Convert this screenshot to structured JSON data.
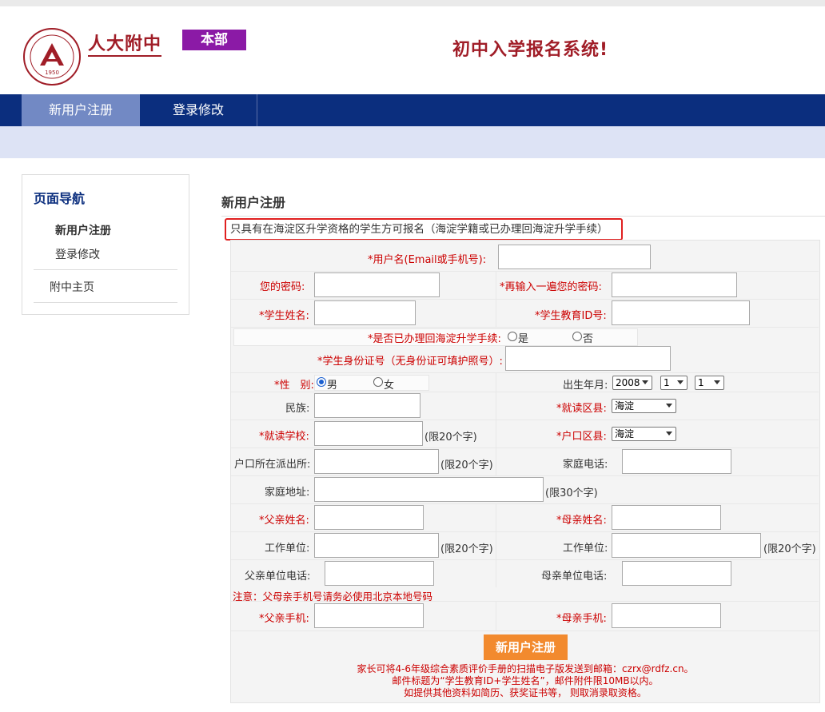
{
  "header": {
    "brand": "人大附中",
    "badge": "本部",
    "system_title": "初中入学报名系统!",
    "logo_year": "1950"
  },
  "nav": {
    "items": [
      {
        "label": "新用户注册",
        "active": true
      },
      {
        "label": "登录修改",
        "active": false
      }
    ]
  },
  "sidebar": {
    "title": "页面导航",
    "links": [
      "新用户注册",
      "登录修改",
      "附中主页"
    ]
  },
  "main": {
    "title": "新用户注册",
    "notice": "只具有在海淀区升学资格的学生方可报名（海淀学籍或已办理回海淀升学手续）"
  },
  "form": {
    "username_label": "*用户名(Email或手机号):",
    "password_label": "您的密码:",
    "password2_label": "*再输入一遍您的密码:",
    "student_name_label": "*学生姓名:",
    "edu_id_label": "*学生教育ID号:",
    "transfer_label": "*是否已办理回海淀升学手续:",
    "transfer_yes": "是",
    "transfer_no": "否",
    "idcard_label": "*学生身份证号（无身份证可填护照号）:",
    "gender_label": "*性　别:",
    "gender_male": "男",
    "gender_female": "女",
    "birth_label": "出生年月:",
    "birth_year": "2008",
    "birth_month": "1",
    "birth_day": "1",
    "ethnicity_label": "民族:",
    "district_label": "*就读区县:",
    "district_value": "海淀",
    "school_label": "*就读学校:",
    "school_hint": "(限20个字)",
    "hukou_district_label": "*户口区县:",
    "hukou_district_value": "海淀",
    "police_label": "户口所在派出所:",
    "police_hint": "(限20个字)",
    "home_phone_label": "家庭电话:",
    "address_label": "家庭地址:",
    "address_hint": "(限30个字)",
    "father_name_label": "*父亲姓名:",
    "mother_name_label": "*母亲姓名:",
    "father_work_label": "工作单位:",
    "father_work_hint": "(限20个字)",
    "mother_work_label": "工作单位:",
    "mother_work_hint": "(限20个字)",
    "father_work_phone_label": "父亲单位电话:",
    "mother_work_phone_label": "母亲单位电话:",
    "phone_note": "注意：父母亲手机号请务必使用北京本地号码",
    "father_mobile_label": "*父亲手机:",
    "mother_mobile_label": "*母亲手机:",
    "submit_label": "新用户注册",
    "footer_lines": [
      "家长可将4-6年级综合素质评价手册的扫描电子版发送到邮箱：czrx@rdfz.cn。",
      "邮件标题为“学生教育ID+学生姓名”，邮件附件限10MB以内。",
      "如提供其他资料如简历、获奖证书等， 则取消录取资格。"
    ]
  },
  "colors": {
    "brand_red": "#a01d27",
    "nav_blue": "#0b2e7e",
    "badge_purple": "#8b1aa6",
    "button_orange": "#f28a2e"
  }
}
